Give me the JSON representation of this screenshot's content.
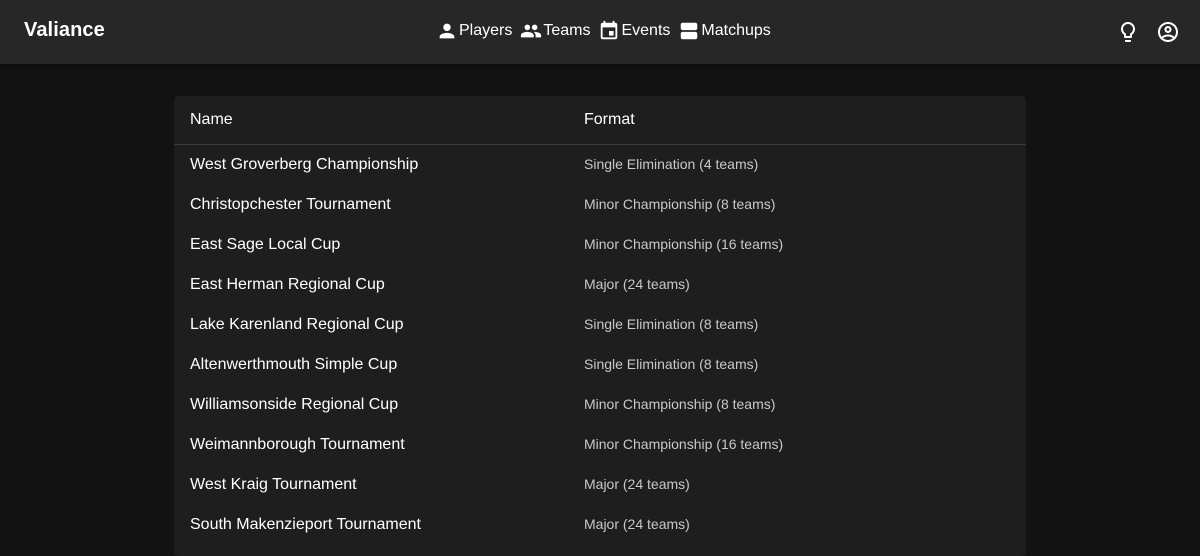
{
  "app": {
    "title": "Valiance"
  },
  "nav": {
    "items": [
      {
        "label": "Players",
        "icon": "person-icon"
      },
      {
        "label": "Teams",
        "icon": "group-icon"
      },
      {
        "label": "Events",
        "icon": "calendar-icon"
      },
      {
        "label": "Matchups",
        "icon": "matchup-icon"
      }
    ]
  },
  "actions": [
    {
      "icon": "lightbulb-icon"
    },
    {
      "icon": "account-circle-icon"
    }
  ],
  "table": {
    "headers": {
      "name": "Name",
      "format": "Format"
    },
    "rows": [
      {
        "name": "West Groverberg Championship",
        "format": "Single Elimination (4 teams)"
      },
      {
        "name": "Christopchester Tournament",
        "format": "Minor Championship (8 teams)"
      },
      {
        "name": "East Sage Local Cup",
        "format": "Minor Championship (16 teams)"
      },
      {
        "name": "East Herman Regional Cup",
        "format": "Major (24 teams)"
      },
      {
        "name": "Lake Karenland Regional Cup",
        "format": "Single Elimination (8 teams)"
      },
      {
        "name": "Altenwerthmouth Simple Cup",
        "format": "Single Elimination (8 teams)"
      },
      {
        "name": "Williamsonside Regional Cup",
        "format": "Minor Championship (8 teams)"
      },
      {
        "name": "Weimannborough Tournament",
        "format": "Minor Championship (16 teams)"
      },
      {
        "name": "West Kraig Tournament",
        "format": "Major (24 teams)"
      },
      {
        "name": "South Makenzieport Tournament",
        "format": "Major (24 teams)"
      }
    ]
  },
  "colors": {
    "background": "#121212",
    "appbar": "#272727",
    "panel": "#1e1e1e",
    "text": "#ffffff",
    "muted": "#c8c8c8"
  }
}
